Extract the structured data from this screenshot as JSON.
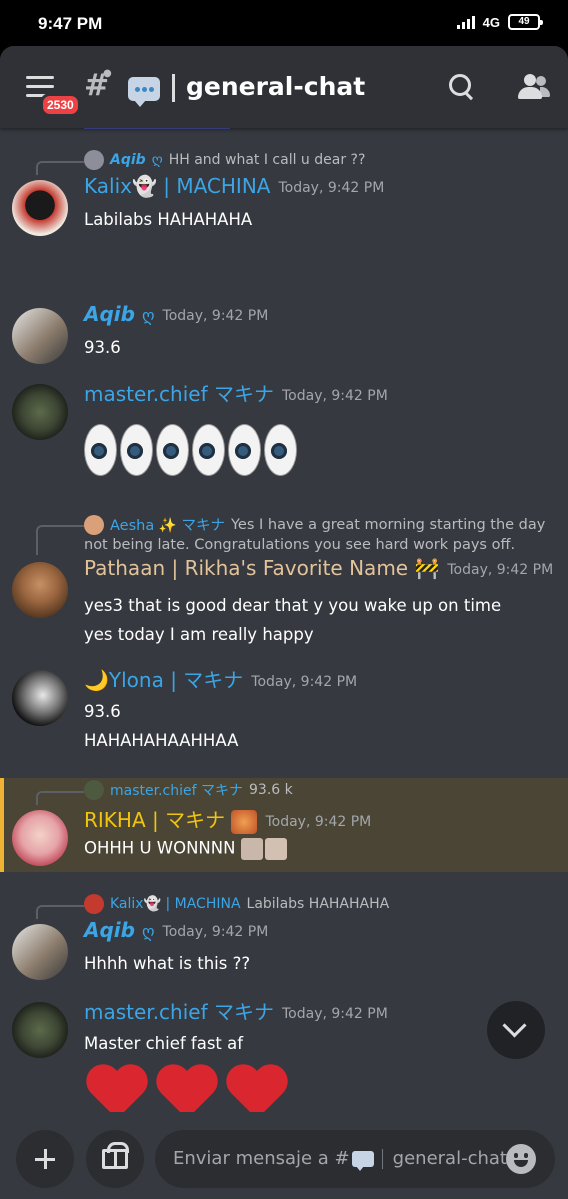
{
  "status_bar": {
    "time": "9:47 PM",
    "network": "4G",
    "battery": "49"
  },
  "header": {
    "channel_name": "general-chat",
    "notification_badge": "2530"
  },
  "messages": [
    {
      "reply_to": {
        "name": "Aqib",
        "text": "HH and what I call u dear ??"
      },
      "username": "Kalix👻 | MACHINA",
      "timestamp": "Today, 9:42 PM",
      "lines": [
        "Labilabs HAHAHAHA"
      ]
    },
    {
      "username": "Aqib",
      "timestamp": "Today, 9:42 PM",
      "lines": [
        "93.6"
      ]
    },
    {
      "username": "master.chief マキナ",
      "timestamp": "Today, 9:42 PM",
      "lines": [],
      "emoji": "eyes x6"
    },
    {
      "reply_to": {
        "name": "Aesha ✨ マキナ",
        "text": "Yes I have a great morning starting the day",
        "text2": "not being late. Congratulations you see hard work pays off."
      },
      "username": "Pathaan | Rikha's Favorite Name 🚧",
      "timestamp": "Today, 9:42 PM",
      "lines": [
        "yes3 that is good dear that y you wake up on time",
        "yes today I am really happy"
      ]
    },
    {
      "username": "🌙Ylona | マキナ",
      "timestamp": "Today, 9:42 PM",
      "lines": [
        "93.6",
        "HAHAHAHAAHHAA"
      ]
    },
    {
      "reply_to": {
        "name": "master.chief マキナ",
        "text": "93.6 k"
      },
      "username": "RIKHA | マキナ",
      "timestamp": "Today, 9:42 PM",
      "lines": [
        "OHHH U WONNNN"
      ]
    },
    {
      "reply_to": {
        "name": "Kalix👻 | MACHINA",
        "text": "Labilabs HAHAHAHA"
      },
      "username": "Aqib",
      "timestamp": "Today, 9:42 PM",
      "lines": [
        "Hhhh what is this ??"
      ]
    },
    {
      "username": "master.chief マキナ",
      "timestamp": "Today, 9:42 PM",
      "lines": [
        "Master chief fast af"
      ],
      "emoji": "hearts x3"
    }
  ],
  "composer": {
    "placeholder_prefix": "Enviar mensaje a #",
    "placeholder_channel": "general-chat"
  },
  "colors": {
    "background": "#36393f",
    "header": "#2f3136",
    "name_blue": "#3ba5e6",
    "name_gold": "#f1c40f",
    "highlight": "#4a4535"
  }
}
